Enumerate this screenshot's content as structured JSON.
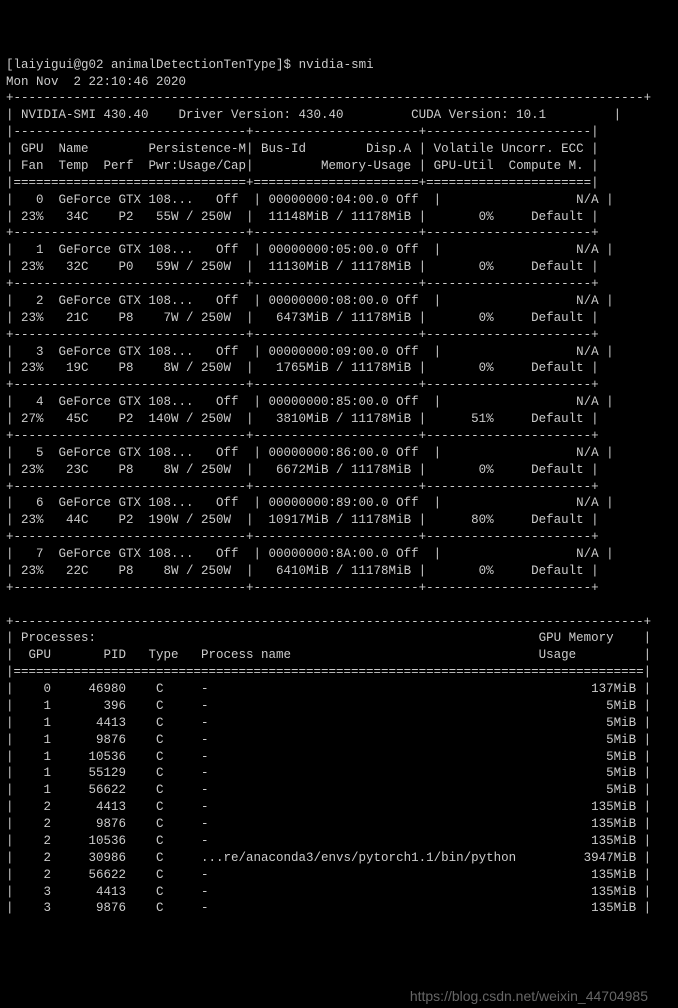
{
  "prompt": "[laiyigui@g02 animalDetectionTenType]$ ",
  "command": "nvidia-smi",
  "timestamp": "Mon Nov  2 22:10:46 2020",
  "header": {
    "smi": "NVIDIA-SMI 430.40",
    "driver": "Driver Version: 430.40",
    "cuda": "CUDA Version: 10.1"
  },
  "cols": {
    "r1a": "GPU  Name        Persistence-M",
    "r1b": "Bus-Id        Disp.A",
    "r1c": "Volatile Uncorr. ECC",
    "r2a": "Fan  Temp  Perf  Pwr:Usage/Cap",
    "r2b": "        Memory-Usage",
    "r2c": "GPU-Util  Compute M."
  },
  "gpus": [
    {
      "idx": "0",
      "name": "GeForce GTX 108...",
      "persist": "Off",
      "bus": "00000000:04:00.0",
      "disp": "Off",
      "ecc": "N/A",
      "fan": "23%",
      "temp": "34C",
      "perf": "P2",
      "pwr": "55W / 250W",
      "mem": "11148MiB / 11178MiB",
      "util": "0%",
      "mode": "Default"
    },
    {
      "idx": "1",
      "name": "GeForce GTX 108...",
      "persist": "Off",
      "bus": "00000000:05:00.0",
      "disp": "Off",
      "ecc": "N/A",
      "fan": "23%",
      "temp": "32C",
      "perf": "P0",
      "pwr": "59W / 250W",
      "mem": "11130MiB / 11178MiB",
      "util": "0%",
      "mode": "Default"
    },
    {
      "idx": "2",
      "name": "GeForce GTX 108...",
      "persist": "Off",
      "bus": "00000000:08:00.0",
      "disp": "Off",
      "ecc": "N/A",
      "fan": "23%",
      "temp": "21C",
      "perf": "P8",
      "pwr": "7W / 250W",
      "mem": "6473MiB / 11178MiB",
      "util": "0%",
      "mode": "Default"
    },
    {
      "idx": "3",
      "name": "GeForce GTX 108...",
      "persist": "Off",
      "bus": "00000000:09:00.0",
      "disp": "Off",
      "ecc": "N/A",
      "fan": "23%",
      "temp": "19C",
      "perf": "P8",
      "pwr": "8W / 250W",
      "mem": "1765MiB / 11178MiB",
      "util": "0%",
      "mode": "Default"
    },
    {
      "idx": "4",
      "name": "GeForce GTX 108...",
      "persist": "Off",
      "bus": "00000000:85:00.0",
      "disp": "Off",
      "ecc": "N/A",
      "fan": "27%",
      "temp": "45C",
      "perf": "P2",
      "pwr": "140W / 250W",
      "mem": "3810MiB / 11178MiB",
      "util": "51%",
      "mode": "Default"
    },
    {
      "idx": "5",
      "name": "GeForce GTX 108...",
      "persist": "Off",
      "bus": "00000000:86:00.0",
      "disp": "Off",
      "ecc": "N/A",
      "fan": "23%",
      "temp": "23C",
      "perf": "P8",
      "pwr": "8W / 250W",
      "mem": "6672MiB / 11178MiB",
      "util": "0%",
      "mode": "Default"
    },
    {
      "idx": "6",
      "name": "GeForce GTX 108...",
      "persist": "Off",
      "bus": "00000000:89:00.0",
      "disp": "Off",
      "ecc": "N/A",
      "fan": "23%",
      "temp": "44C",
      "perf": "P2",
      "pwr": "190W / 250W",
      "mem": "10917MiB / 11178MiB",
      "util": "80%",
      "mode": "Default"
    },
    {
      "idx": "7",
      "name": "GeForce GTX 108...",
      "persist": "Off",
      "bus": "00000000:8A:00.0",
      "disp": "Off",
      "ecc": "N/A",
      "fan": "23%",
      "temp": "22C",
      "perf": "P8",
      "pwr": "8W / 250W",
      "mem": "6410MiB / 11178MiB",
      "util": "0%",
      "mode": "Default"
    }
  ],
  "proc_header": {
    "title": "Processes:",
    "memcol": "GPU Memory",
    "cols": " GPU       PID   Type   Process name",
    "usage": "Usage"
  },
  "processes": [
    {
      "gpu": "0",
      "pid": "46980",
      "type": "C",
      "name": "-",
      "mem": "137MiB"
    },
    {
      "gpu": "1",
      "pid": "396",
      "type": "C",
      "name": "-",
      "mem": "5MiB"
    },
    {
      "gpu": "1",
      "pid": "4413",
      "type": "C",
      "name": "-",
      "mem": "5MiB"
    },
    {
      "gpu": "1",
      "pid": "9876",
      "type": "C",
      "name": "-",
      "mem": "5MiB"
    },
    {
      "gpu": "1",
      "pid": "10536",
      "type": "C",
      "name": "-",
      "mem": "5MiB"
    },
    {
      "gpu": "1",
      "pid": "55129",
      "type": "C",
      "name": "-",
      "mem": "5MiB"
    },
    {
      "gpu": "1",
      "pid": "56622",
      "type": "C",
      "name": "-",
      "mem": "5MiB"
    },
    {
      "gpu": "2",
      "pid": "4413",
      "type": "C",
      "name": "-",
      "mem": "135MiB"
    },
    {
      "gpu": "2",
      "pid": "9876",
      "type": "C",
      "name": "-",
      "mem": "135MiB"
    },
    {
      "gpu": "2",
      "pid": "10536",
      "type": "C",
      "name": "-",
      "mem": "135MiB"
    },
    {
      "gpu": "2",
      "pid": "30986",
      "type": "C",
      "name": "...re/anaconda3/envs/pytorch1.1/bin/python",
      "mem": "3947MiB"
    },
    {
      "gpu": "2",
      "pid": "56622",
      "type": "C",
      "name": "-",
      "mem": "135MiB"
    },
    {
      "gpu": "3",
      "pid": "4413",
      "type": "C",
      "name": "-",
      "mem": "135MiB"
    },
    {
      "gpu": "3",
      "pid": "9876",
      "type": "C",
      "name": "-",
      "mem": "135MiB"
    }
  ],
  "watermark": "https://blog.csdn.net/weixin_44704985"
}
